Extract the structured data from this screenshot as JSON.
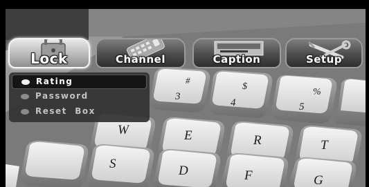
{
  "menu": {
    "tabs": [
      {
        "label": "Lock",
        "icon": "lock-icon",
        "active": true
      },
      {
        "label": "Channel",
        "icon": "remote-control-icon",
        "active": false
      },
      {
        "label": "Caption",
        "icon": "caption-tv-icon",
        "active": false
      },
      {
        "label": "Setup",
        "icon": "wrench-screwdriver-icon",
        "active": false
      }
    ]
  },
  "lock_menu": {
    "items": [
      {
        "label": "Rating",
        "selected": true
      },
      {
        "label": "Password",
        "selected": false
      },
      {
        "label": "Reset  Box",
        "selected": false
      }
    ]
  },
  "background": {
    "key_labels": [
      "3",
      "#",
      "4",
      "$",
      "5",
      "%",
      "W",
      "E",
      "R",
      "T",
      "S",
      "D",
      "F",
      "G"
    ]
  },
  "colors": {
    "active_tab": "#d8d8d8",
    "inactive_tab": "#4c4c4c",
    "dropdown_bg": "#343434",
    "selected_item_bg": "#151515",
    "text": "#ffffff"
  }
}
